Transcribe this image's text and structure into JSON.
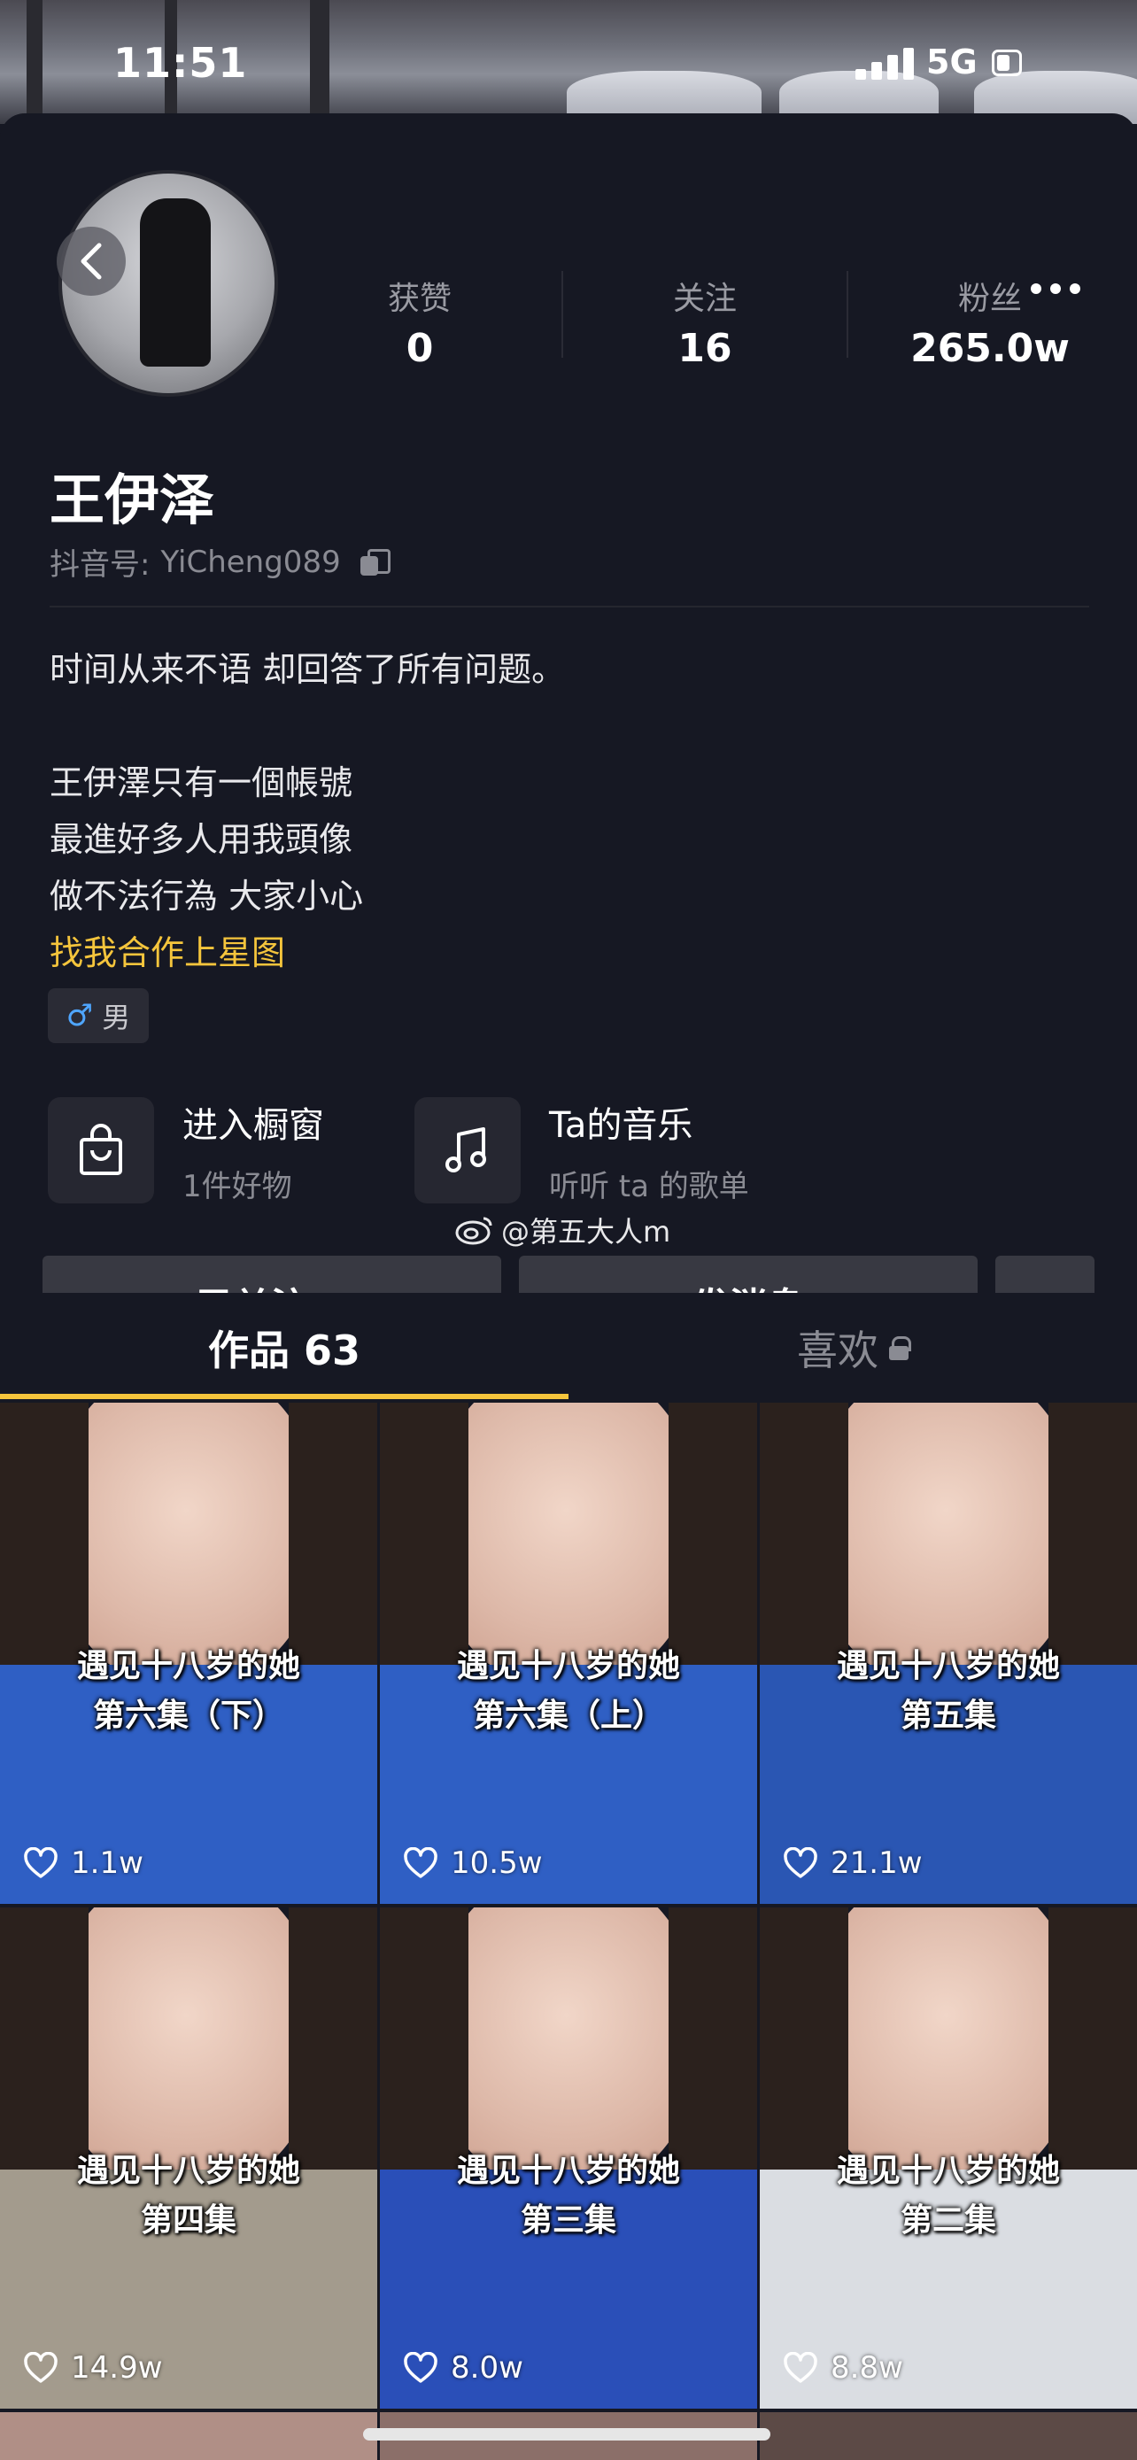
{
  "status_bar": {
    "time": "11:51",
    "network": "5G"
  },
  "profile": {
    "stats": [
      {
        "label": "获赞",
        "value": "0"
      },
      {
        "label": "关注",
        "value": "16"
      },
      {
        "label": "粉丝",
        "value": "265.0w"
      }
    ],
    "name": "王伊泽",
    "douyin_id_label": "抖音号:",
    "douyin_id": "YiCheng089",
    "bio": {
      "line1": "时间从来不语 却回答了所有问题。",
      "line2": "王伊澤只有一個帳號",
      "line3": "最進好多人用我頭像",
      "line4": "做不法行為 大家小心",
      "highlight": "找我合作上星图"
    },
    "gender_symbol": "♂",
    "gender": "男"
  },
  "features": [
    {
      "title": "进入橱窗",
      "subtitle": "1件好物",
      "icon": "shopping-bag-icon"
    },
    {
      "title": "Ta的音乐",
      "subtitle": "听听 ta 的歌单",
      "icon": "music-note-icon"
    }
  ],
  "actions": {
    "followed": "已关注",
    "message": "发消息"
  },
  "watermark": "@第五大人m",
  "tabs": {
    "works": "作品 63",
    "likes": "喜欢"
  },
  "videos": [
    {
      "title1": "遇见十八岁的她",
      "title2": "第六集（下）",
      "likes": "1.1w",
      "shirt": "#2f5fc4"
    },
    {
      "title1": "遇见十八岁的她",
      "title2": "第六集（上）",
      "likes": "10.5w",
      "shirt": "#2f5fc4"
    },
    {
      "title1": "遇见十八岁的她",
      "title2": "第五集",
      "likes": "21.1w",
      "shirt": "#2a56b3"
    },
    {
      "title1": "遇见十八岁的她",
      "title2": "第四集",
      "likes": "14.9w",
      "shirt": "#a39b8d"
    },
    {
      "title1": "遇见十八岁的她",
      "title2": "第三集",
      "likes": "8.0w",
      "shirt": "#2a4fb8"
    },
    {
      "title1": "遇见十八岁的她",
      "title2": "第二集",
      "likes": "8.8w",
      "shirt": "#dadde2"
    }
  ],
  "colors": {
    "background": "#161823",
    "accent": "#f5c53c",
    "button": "#383942",
    "muted": "#8a8b93"
  }
}
